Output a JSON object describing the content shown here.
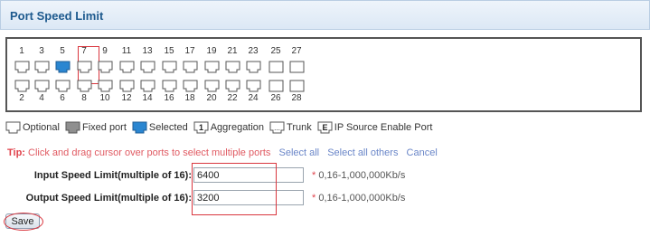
{
  "header": {
    "title": "Port Speed Limit"
  },
  "ports": {
    "top": [
      {
        "num": "1",
        "state": "optional"
      },
      {
        "num": "3",
        "state": "optional"
      },
      {
        "num": "5",
        "state": "selected"
      },
      {
        "num": "7",
        "state": "optional"
      },
      {
        "num": "9",
        "state": "optional"
      },
      {
        "num": "11",
        "state": "optional"
      },
      {
        "num": "13",
        "state": "optional"
      },
      {
        "num": "15",
        "state": "optional"
      },
      {
        "num": "17",
        "state": "optional"
      },
      {
        "num": "19",
        "state": "optional"
      },
      {
        "num": "21",
        "state": "optional"
      },
      {
        "num": "23",
        "state": "optional"
      },
      {
        "num": "25",
        "state": "fiber"
      },
      {
        "num": "27",
        "state": "fiber"
      }
    ],
    "bottom": [
      {
        "num": "2",
        "state": "optional"
      },
      {
        "num": "4",
        "state": "optional"
      },
      {
        "num": "6",
        "state": "optional"
      },
      {
        "num": "8",
        "state": "optional"
      },
      {
        "num": "10",
        "state": "optional"
      },
      {
        "num": "12",
        "state": "optional"
      },
      {
        "num": "14",
        "state": "optional"
      },
      {
        "num": "16",
        "state": "optional"
      },
      {
        "num": "18",
        "state": "optional"
      },
      {
        "num": "20",
        "state": "optional"
      },
      {
        "num": "22",
        "state": "optional"
      },
      {
        "num": "24",
        "state": "optional"
      },
      {
        "num": "26",
        "state": "fiber"
      },
      {
        "num": "28",
        "state": "fiber"
      }
    ]
  },
  "legend": {
    "optional": "Optional",
    "fixed": "Fixed port",
    "selected": "Selected",
    "aggregation": "Aggregation",
    "aggregation_glyph": "1",
    "trunk": "Trunk",
    "trunk_glyph": "...",
    "ipsource": "IP Source Enable Port",
    "ipsource_glyph": "E"
  },
  "tip": {
    "label": "Tip:",
    "text": "Click and drag cursor over ports to select multiple ports",
    "select_all": "Select all",
    "select_all_others": "Select all others",
    "cancel": "Cancel"
  },
  "form": {
    "input_label": "Input Speed Limit(multiple of 16):",
    "input_value": "6400",
    "input_hint_star": "*",
    "input_hint": "0,16-1,000,000Kb/s",
    "output_label": "Output Speed Limit(multiple of 16):",
    "output_value": "3200",
    "output_hint_star": "*",
    "output_hint": "0,16-1,000,000Kb/s"
  },
  "actions": {
    "save": "Save"
  },
  "colors": {
    "accent": "#1e5a8e",
    "selected_port": "#2a86d1",
    "highlight": "#d9363e",
    "link": "#6a86c8"
  }
}
